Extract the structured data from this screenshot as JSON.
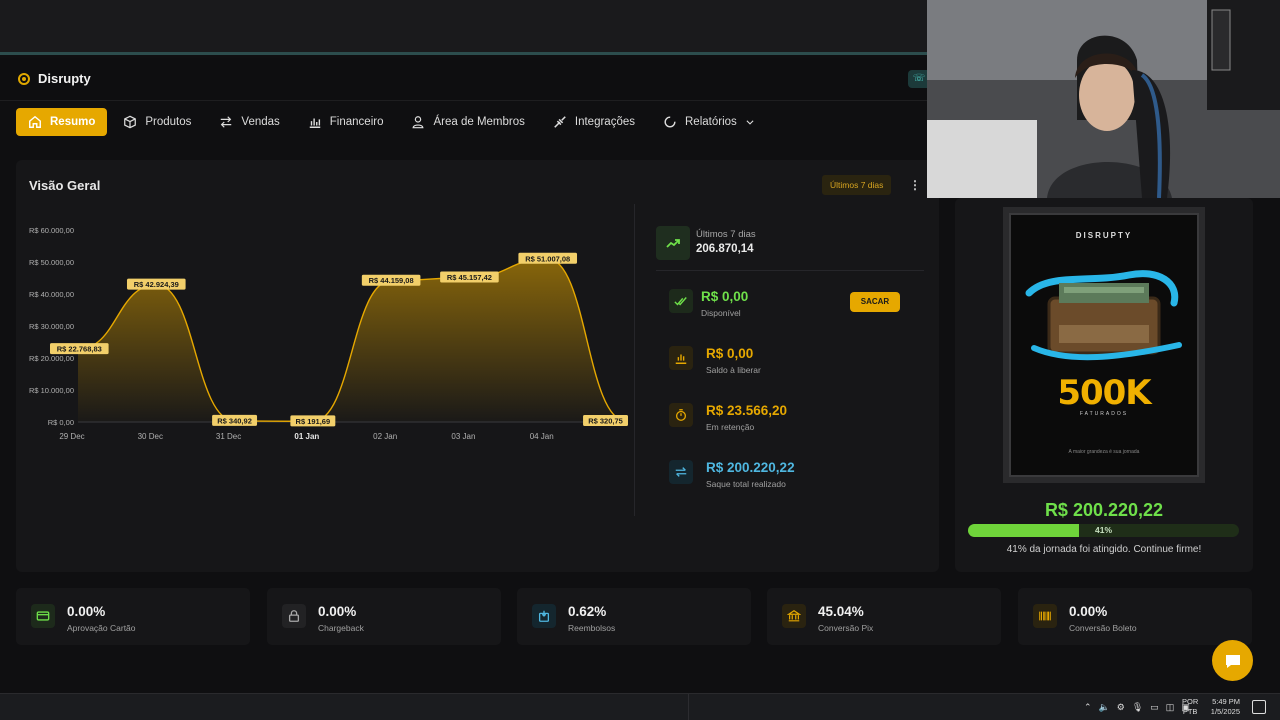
{
  "app": {
    "name": "Disrupty"
  },
  "nav": {
    "items": [
      {
        "label": "Resumo",
        "active": true,
        "icon": "home-icon"
      },
      {
        "label": "Produtos",
        "icon": "box-icon"
      },
      {
        "label": "Vendas",
        "icon": "arrows-exchange-icon"
      },
      {
        "label": "Financeiro",
        "icon": "chart-bars-icon"
      },
      {
        "label": "Área de Membros",
        "icon": "user-icon"
      },
      {
        "label": "Integrações",
        "icon": "plug-icon"
      },
      {
        "label": "Relatórios",
        "icon": "circle-chart-icon"
      }
    ]
  },
  "overview": {
    "title": "Visão Geral",
    "period": "Últimos 7 dias",
    "summary": {
      "period_label": "Últimos 7 dias",
      "total": "206.870,14"
    },
    "balances": [
      {
        "amount": "R$ 0,00",
        "label": "Disponível",
        "color": "#6fe04a"
      },
      {
        "amount": "R$ 0,00",
        "label": "Saldo à liberar",
        "color": "#e6a800"
      },
      {
        "amount": "R$ 23.566,20",
        "label": "Em retenção",
        "color": "#e6a800"
      },
      {
        "amount": "R$ 200.220,22",
        "label": "Saque total realizado",
        "color": "#4fb7e0"
      }
    ],
    "withdraw_label": "SACAR"
  },
  "chart_data": {
    "type": "area",
    "categories": [
      "29 Dec",
      "30 Dec",
      "31 Dec",
      "01 Jan",
      "02 Jan",
      "03 Jan",
      "04 Jan",
      ""
    ],
    "values": [
      22768.83,
      42924.39,
      340.92,
      191.69,
      44159.08,
      45157.42,
      51007.08,
      320.75
    ],
    "point_labels": [
      "R$ 22.768,83",
      "R$ 42.924,39",
      "R$ 340,92",
      "R$ 191,69",
      "R$ 44.159,08",
      "R$ 45.157,42",
      "R$ 51.007,08",
      "R$ 320,75"
    ],
    "y_ticks": [
      "R$ 0,00",
      "R$ 10.000,00",
      "R$ 20.000,00",
      "R$ 30.000,00",
      "R$ 40.000,00",
      "R$ 50.000,00",
      "R$ 60.000,00"
    ],
    "ylim": [
      0,
      60000
    ],
    "grid": false,
    "color": "#e6a800"
  },
  "goal": {
    "poster_brand": "DISRUPTY",
    "poster_headline": "500K",
    "poster_sub": "FATURADOS",
    "poster_tagline": "A maior grandeza é sua jornada",
    "amount": "R$ 200.220,22",
    "progress": 0.41,
    "progress_label": "41%",
    "message": "41% da jornada foi atingido. Continue firme!"
  },
  "metrics": [
    {
      "value": "0.00%",
      "label": "Aprovação Cartão",
      "icon": "card-icon",
      "color": "#6fe04a"
    },
    {
      "value": "0.00%",
      "label": "Chargeback",
      "icon": "lock-icon",
      "color": "#a8a8a8"
    },
    {
      "value": "0.62%",
      "label": "Reembolsos",
      "icon": "refund-icon",
      "color": "#4fb7e0"
    },
    {
      "value": "45.04%",
      "label": "Conversão Pix",
      "icon": "bank-icon",
      "color": "#e6a800"
    },
    {
      "value": "0.00%",
      "label": "Conversão Boleto",
      "icon": "barcode-icon",
      "color": "#e6a800"
    }
  ],
  "taskbar": {
    "lang_top": "POR",
    "lang_bottom": "PTB",
    "time": "5:49 PM",
    "date": "1/5/2025"
  }
}
